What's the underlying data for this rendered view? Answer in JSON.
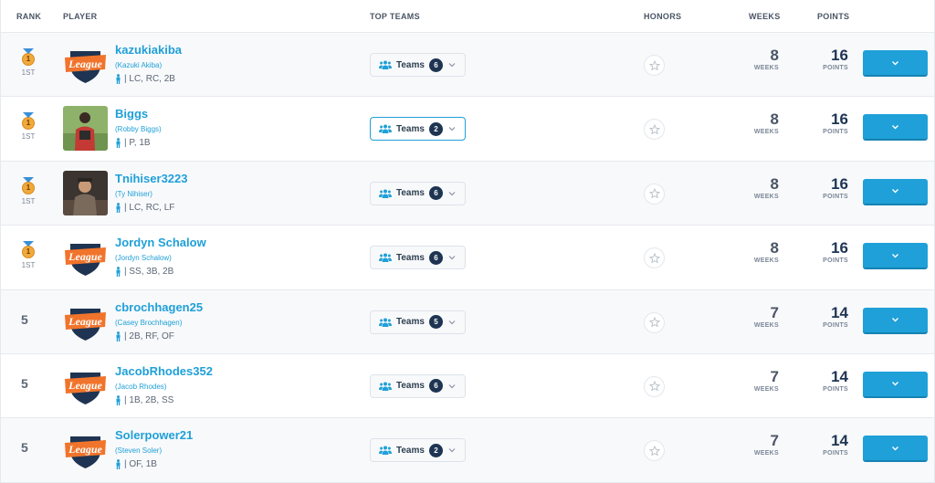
{
  "header": {
    "rank": "RANK",
    "player": "PLAYER",
    "top_teams": "TOP TEAMS",
    "honors": "HONORS",
    "weeks": "WEEKS",
    "points": "POINTS"
  },
  "labels": {
    "teams": "Teams",
    "weeks_unit": "WEEKS",
    "points_unit": "POINTS",
    "medal_rank": "1",
    "medal_label": "1ST",
    "logo_text": "League"
  },
  "colors": {
    "accent": "#1fa0d8",
    "navy": "#1e3452",
    "medal": "#f2a93b",
    "logo_orange": "#f0742c"
  },
  "rows": [
    {
      "rank": "1ST",
      "medal": true,
      "name": "kazukiakiba",
      "real_name": "(Kazuki Akiba)",
      "positions": "| LC, RC, 2B",
      "teams_count": "6",
      "weeks": "8",
      "points": "16",
      "avatar": "league-logo",
      "active": false
    },
    {
      "rank": "1ST",
      "medal": true,
      "name": "Biggs",
      "real_name": "(Robby Biggs)",
      "positions": "| P, 1B",
      "teams_count": "2",
      "weeks": "8",
      "points": "16",
      "avatar": "photo",
      "active": true
    },
    {
      "rank": "1ST",
      "medal": true,
      "name": "Tnihiser3223",
      "real_name": "(Ty Nihiser)",
      "positions": "| LC, RC, LF",
      "teams_count": "6",
      "weeks": "8",
      "points": "16",
      "avatar": "photo2",
      "active": false
    },
    {
      "rank": "1ST",
      "medal": true,
      "name": "Jordyn Schalow",
      "real_name": "(Jordyn Schalow)",
      "positions": "| SS, 3B, 2B",
      "teams_count": "6",
      "weeks": "8",
      "points": "16",
      "avatar": "league-logo",
      "active": false
    },
    {
      "rank": "5",
      "medal": false,
      "name": "cbrochhagen25",
      "real_name": "(Casey Brochhagen)",
      "positions": "| 2B, RF, OF",
      "teams_count": "5",
      "weeks": "7",
      "points": "14",
      "avatar": "league-logo",
      "active": false
    },
    {
      "rank": "5",
      "medal": false,
      "name": "JacobRhodes352",
      "real_name": "(Jacob Rhodes)",
      "positions": "| 1B, 2B, SS",
      "teams_count": "6",
      "weeks": "7",
      "points": "14",
      "avatar": "league-logo",
      "active": false
    },
    {
      "rank": "5",
      "medal": false,
      "name": "Solerpower21",
      "real_name": "(Steven Soler)",
      "positions": "| OF, 1B",
      "teams_count": "2",
      "weeks": "7",
      "points": "14",
      "avatar": "league-logo",
      "active": false
    }
  ]
}
